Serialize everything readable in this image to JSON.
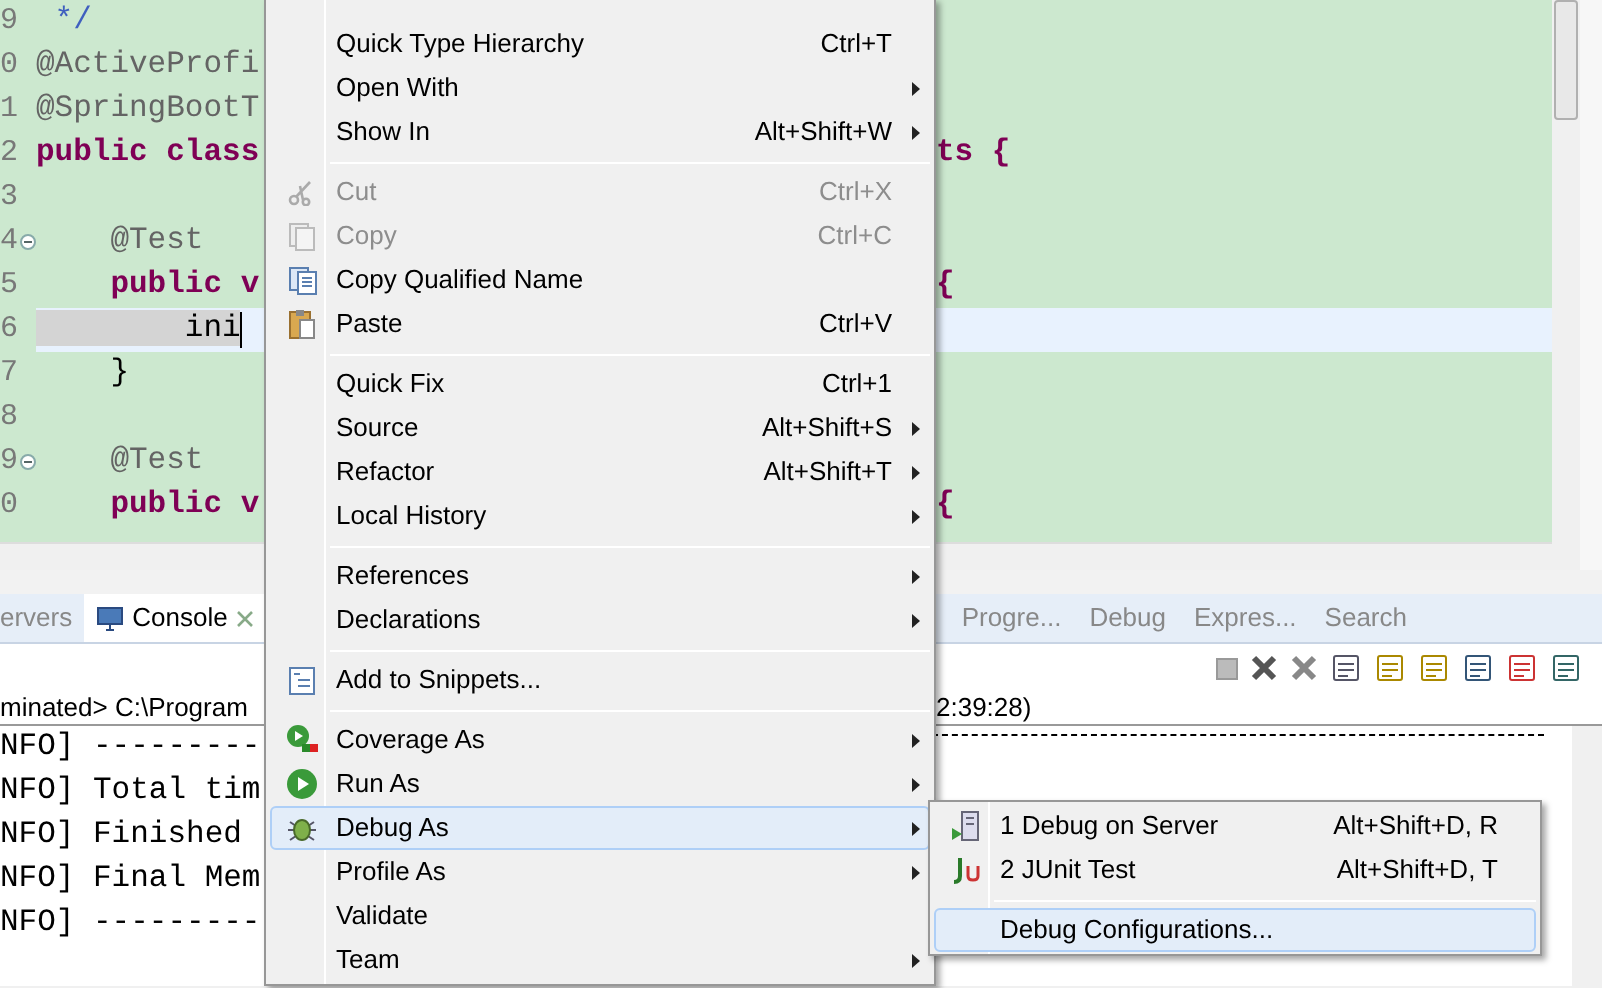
{
  "editor": {
    "lines": [
      {
        "number": "9",
        "kind": "comment",
        "left": " */",
        "foldable": false,
        "current": false
      },
      {
        "number": "0",
        "kind": "annotation",
        "left": "@ActiveProfi",
        "foldable": false,
        "current": false
      },
      {
        "number": "1",
        "kind": "annotation",
        "left": "@SpringBootT",
        "foldable": false,
        "current": false
      },
      {
        "number": "2",
        "kind": "keyword",
        "left": "public class",
        "right": "ts {",
        "foldable": false,
        "current": false
      },
      {
        "number": "3",
        "foldable": false,
        "current": false
      },
      {
        "number": "4",
        "kind": "annotation",
        "left": "    @Test",
        "foldable": true,
        "current": false
      },
      {
        "number": "5",
        "kind": "keyword",
        "left": "    public v",
        "right": "{",
        "foldable": false,
        "current": false
      },
      {
        "number": "6",
        "kind": "plain",
        "left": "        ini",
        "foldable": false,
        "current": true
      },
      {
        "number": "7",
        "kind": "plain",
        "left": "    }",
        "foldable": false,
        "current": false
      },
      {
        "number": "8",
        "foldable": false,
        "current": false
      },
      {
        "number": "9",
        "kind": "annotation",
        "left": "    @Test",
        "foldable": true,
        "current": false
      },
      {
        "number": "0",
        "kind": "keyword",
        "left": "    public v",
        "right": "{",
        "foldable": false,
        "current": false
      }
    ]
  },
  "bottom_panel": {
    "tabs": [
      {
        "label": "ervers",
        "selected": false,
        "closable": false
      },
      {
        "label": "Console",
        "selected": true,
        "closable": true
      }
    ],
    "right_tabs": [
      "Progre...",
      "Debug",
      "Expres...",
      "Search"
    ],
    "process_left": "minated> C:\\Program",
    "process_right": "2:39:28)",
    "console_lines": [
      "NFO] ---------",
      "NFO] Total tim",
      "NFO] Finished",
      "NFO] Final Mem",
      "NFO] ---------"
    ]
  },
  "context_menu": {
    "items": [
      {
        "kind": "item",
        "label": "Quick Type Hierarchy",
        "shortcut": "Ctrl+T",
        "submenu": false,
        "disabled": false,
        "selected": false
      },
      {
        "kind": "item",
        "label": "Open With",
        "submenu": true,
        "disabled": false,
        "selected": false
      },
      {
        "kind": "item",
        "label": "Show In",
        "shortcut": "Alt+Shift+W",
        "submenu": true,
        "disabled": false,
        "selected": false
      },
      {
        "kind": "separator"
      },
      {
        "kind": "item",
        "label": "Cut",
        "shortcut": "Ctrl+X",
        "submenu": false,
        "disabled": true,
        "selected": false
      },
      {
        "kind": "item",
        "label": "Copy",
        "shortcut": "Ctrl+C",
        "submenu": false,
        "disabled": true,
        "selected": false
      },
      {
        "kind": "item",
        "label": "Copy Qualified Name",
        "submenu": false,
        "disabled": false,
        "selected": false
      },
      {
        "kind": "item",
        "label": "Paste",
        "shortcut": "Ctrl+V",
        "submenu": false,
        "disabled": false,
        "selected": false
      },
      {
        "kind": "separator"
      },
      {
        "kind": "item",
        "label": "Quick Fix",
        "shortcut": "Ctrl+1",
        "submenu": false,
        "disabled": false,
        "selected": false
      },
      {
        "kind": "item",
        "label": "Source",
        "shortcut": "Alt+Shift+S",
        "submenu": true,
        "disabled": false,
        "selected": false
      },
      {
        "kind": "item",
        "label": "Refactor",
        "shortcut": "Alt+Shift+T",
        "submenu": true,
        "disabled": false,
        "selected": false
      },
      {
        "kind": "item",
        "label": "Local History",
        "submenu": true,
        "disabled": false,
        "selected": false
      },
      {
        "kind": "separator"
      },
      {
        "kind": "item",
        "label": "References",
        "submenu": true,
        "disabled": false,
        "selected": false
      },
      {
        "kind": "item",
        "label": "Declarations",
        "submenu": true,
        "disabled": false,
        "selected": false
      },
      {
        "kind": "separator"
      },
      {
        "kind": "item",
        "label": "Add to Snippets...",
        "submenu": false,
        "disabled": false,
        "selected": false
      },
      {
        "kind": "separator"
      },
      {
        "kind": "item",
        "label": "Coverage As",
        "submenu": true,
        "disabled": false,
        "selected": false
      },
      {
        "kind": "item",
        "label": "Run As",
        "submenu": true,
        "disabled": false,
        "selected": false
      },
      {
        "kind": "item",
        "label": "Debug As",
        "submenu": true,
        "disabled": false,
        "selected": true
      },
      {
        "kind": "item",
        "label": "Profile As",
        "submenu": true,
        "disabled": false,
        "selected": false
      },
      {
        "kind": "item",
        "label": "Validate",
        "submenu": false,
        "disabled": false,
        "selected": false
      },
      {
        "kind": "item",
        "label": "Team",
        "submenu": true,
        "disabled": false,
        "selected": false
      }
    ]
  },
  "submenu": {
    "items": [
      {
        "kind": "item",
        "label": "1 Debug on Server",
        "shortcut": "Alt+Shift+D, R",
        "selected": false
      },
      {
        "kind": "item",
        "label": "2 JUnit Test",
        "shortcut": "Alt+Shift+D, T",
        "selected": false
      },
      {
        "kind": "separator"
      },
      {
        "kind": "item",
        "label": "Debug Configurations...",
        "selected": true
      }
    ]
  }
}
